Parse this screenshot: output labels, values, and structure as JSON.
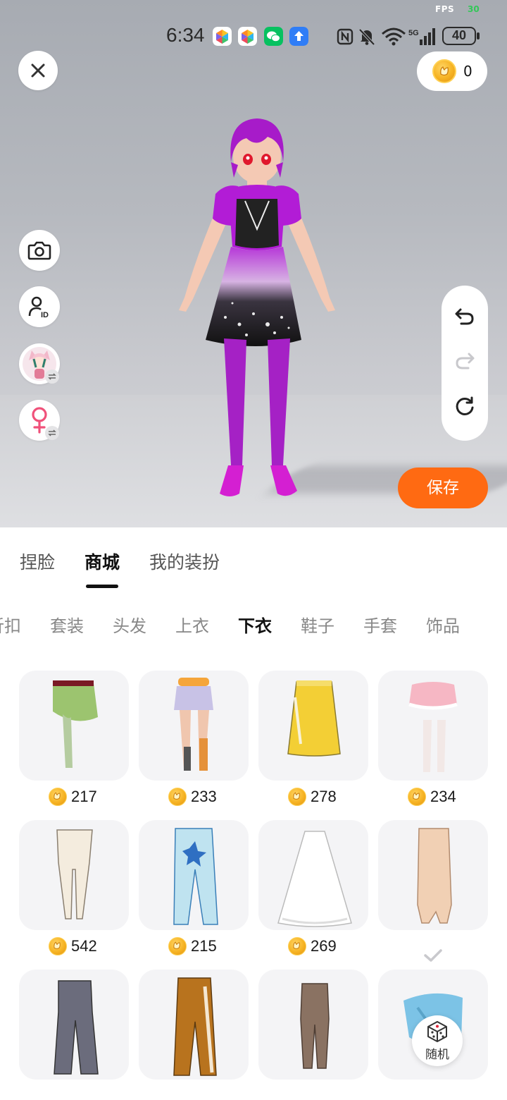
{
  "status_bar": {
    "time": "6:34",
    "fps_label": "FPS",
    "fps_value": "30",
    "battery": "40",
    "network": "5G"
  },
  "header": {
    "coin_balance": "0"
  },
  "side_buttons": [
    "camera-icon",
    "id-icon",
    "avatar-switch",
    "gender-switch"
  ],
  "actions": {
    "save_label": "保存"
  },
  "main_tabs": [
    {
      "label": "捏脸",
      "active": false
    },
    {
      "label": "商城",
      "active": true
    },
    {
      "label": "我的装扮",
      "active": false
    }
  ],
  "categories": [
    {
      "label": "折扣",
      "active": false
    },
    {
      "label": "套装",
      "active": false
    },
    {
      "label": "头发",
      "active": false
    },
    {
      "label": "上衣",
      "active": false
    },
    {
      "label": "下衣",
      "active": true
    },
    {
      "label": "鞋子",
      "active": false
    },
    {
      "label": "手套",
      "active": false
    },
    {
      "label": "饰品",
      "active": false
    }
  ],
  "items": [
    {
      "name": "green-asymmetric-skirt",
      "price": "217",
      "owned": false
    },
    {
      "name": "lilac-shorts-with-boots",
      "price": "233",
      "owned": false
    },
    {
      "name": "yellow-pencil-skirt",
      "price": "278",
      "owned": false
    },
    {
      "name": "pink-frill-skirt",
      "price": "234",
      "owned": false
    },
    {
      "name": "cream-leggings",
      "price": "542",
      "owned": false
    },
    {
      "name": "blue-star-pants",
      "price": "215",
      "owned": false
    },
    {
      "name": "white-lace-skirt",
      "price": "269",
      "owned": false
    },
    {
      "name": "beige-long-skirt",
      "price": "",
      "owned": true
    },
    {
      "name": "gray-flare-jeans",
      "price": "",
      "owned": true
    },
    {
      "name": "brown-track-pants",
      "price": "",
      "owned": true
    },
    {
      "name": "brown-leggings",
      "price": "",
      "owned": true
    },
    {
      "name": "blue-wrap-skirt",
      "price": "",
      "owned": true
    }
  ],
  "random_button": {
    "label": "随机"
  },
  "colors": {
    "accent": "#ff6a12",
    "coin": "#f6b323"
  }
}
